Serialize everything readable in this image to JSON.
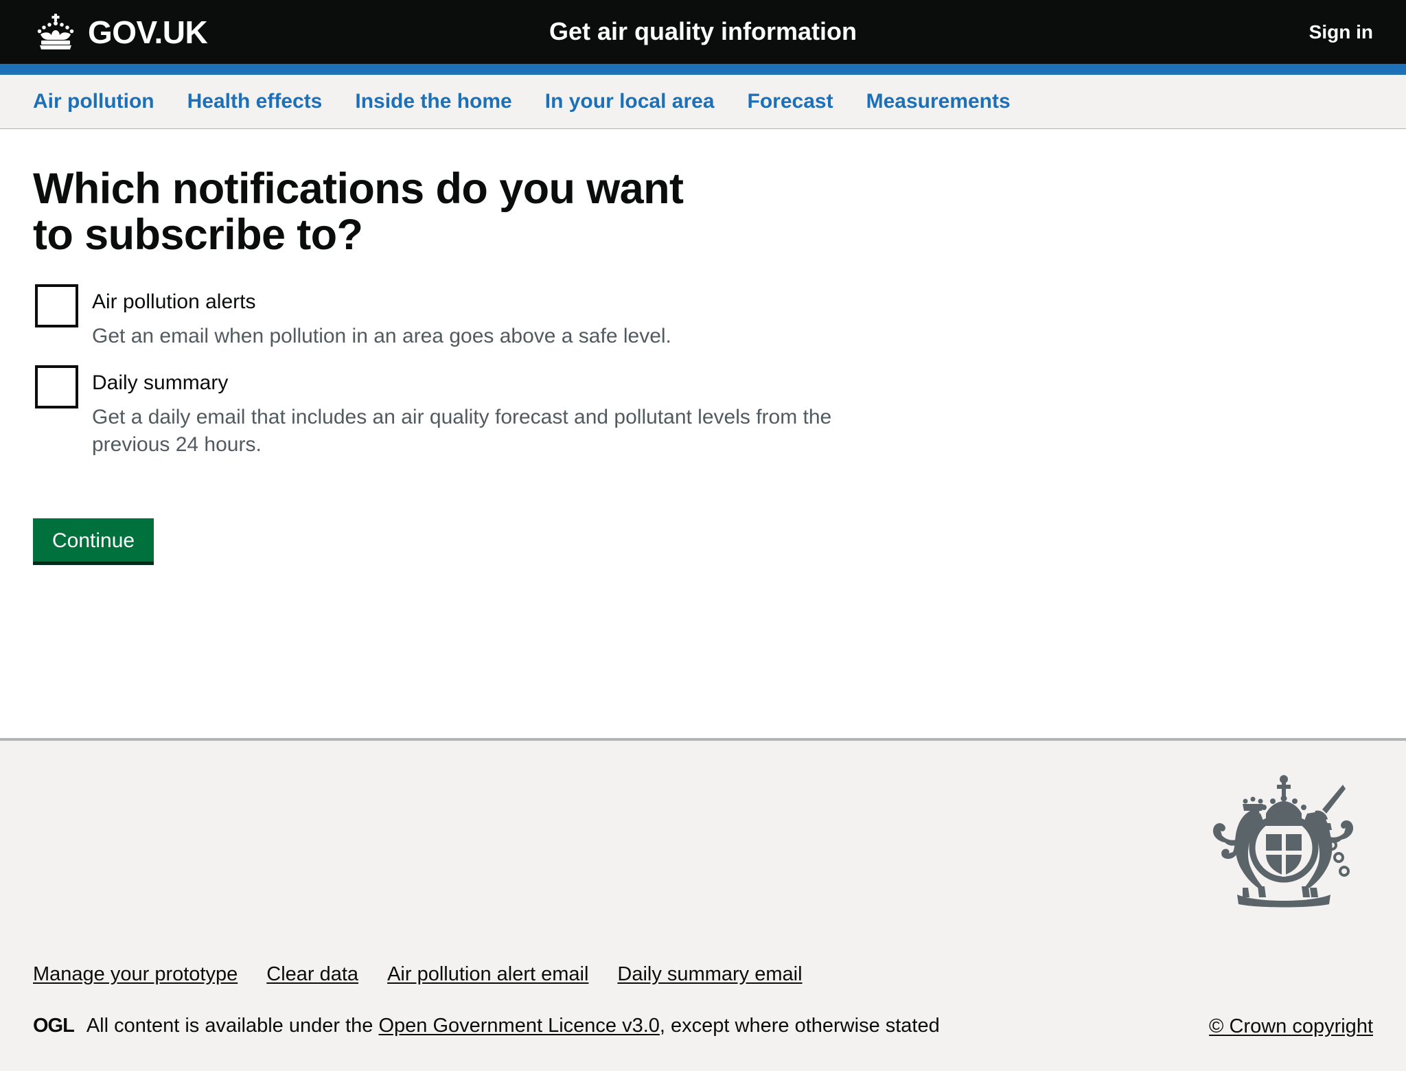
{
  "header": {
    "brand_text": "GOV.UK",
    "crown_icon": "crown-icon",
    "service_name": "Get air quality information",
    "sign_in_label": "Sign in"
  },
  "nav": {
    "items": [
      {
        "label": "Air pollution"
      },
      {
        "label": "Health effects"
      },
      {
        "label": "Inside the home"
      },
      {
        "label": "In your local area"
      },
      {
        "label": "Forecast"
      },
      {
        "label": "Measurements"
      }
    ]
  },
  "main": {
    "heading": "Which notifications do you want to subscribe to?",
    "checkboxes": [
      {
        "label": "Air pollution alerts",
        "hint": "Get an email when pollution in an area goes above a safe level.",
        "checked": false
      },
      {
        "label": "Daily summary",
        "hint": "Get a daily email that includes an air quality forecast and pollutant levels from the previous 24 hours.",
        "checked": false
      }
    ],
    "continue_label": "Continue"
  },
  "footer": {
    "crest_icon": "royal-coat-of-arms-icon",
    "links": [
      {
        "label": "Manage your prototype"
      },
      {
        "label": "Clear data"
      },
      {
        "label": "Air pollution alert email"
      },
      {
        "label": "Daily summary email"
      }
    ],
    "ogl_logo_text": "OGL",
    "licence_prefix": "All content is available under the ",
    "licence_link": "Open Government Licence v3.0",
    "licence_suffix": ", except where otherwise stated",
    "crown_copyright": "© Crown copyright"
  },
  "colors": {
    "header_black": "#0b0c0c",
    "accent_blue": "#1d70b8",
    "nav_background": "#f3f2f1",
    "button_green": "#00703c",
    "button_green_shadow": "#002d18",
    "hint_grey": "#505a5f",
    "footer_border": "#b1b4b6",
    "crest_grey": "#5a6469"
  }
}
